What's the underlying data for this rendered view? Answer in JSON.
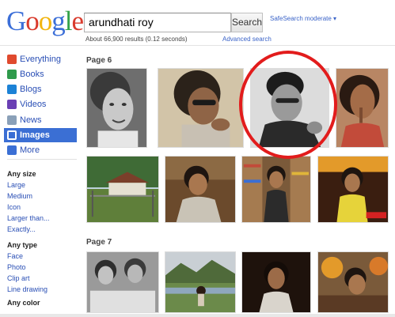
{
  "header": {
    "logo_letters": [
      {
        "ch": "G",
        "color": "#3c6fd8"
      },
      {
        "ch": "o",
        "color": "#d93b2d"
      },
      {
        "ch": "o",
        "color": "#f2b50f"
      },
      {
        "ch": "g",
        "color": "#3c6fd8"
      },
      {
        "ch": "l",
        "color": "#35a34a"
      },
      {
        "ch": "e",
        "color": "#d93b2d"
      }
    ],
    "search_value": "arundhati roy",
    "search_button": "Search",
    "safesearch": "SafeSearch moderate ▾",
    "result_stats": "About 66,900 results (0.12 seconds)",
    "advanced_search": "Advanced search"
  },
  "sidebar": {
    "items": [
      {
        "label": "Everything",
        "icon": "everything-icon",
        "color": "#e04a2e",
        "active": false
      },
      {
        "label": "Books",
        "icon": "books-icon",
        "color": "#2f9a4b",
        "active": false
      },
      {
        "label": "Blogs",
        "icon": "blogs-icon",
        "color": "#1c82d6",
        "active": false
      },
      {
        "label": "Videos",
        "icon": "videos-icon",
        "color": "#6a3fb4",
        "active": false
      },
      {
        "label": "News",
        "icon": "news-icon",
        "color": "#8aa0b8",
        "active": false
      },
      {
        "label": "Images",
        "icon": "images-icon",
        "color": "#ffffff",
        "active": true
      },
      {
        "label": "More",
        "icon": "more-icon",
        "color": "#3b6fd4",
        "active": false
      }
    ],
    "size_heading": "Any size",
    "size_options": [
      "Large",
      "Medium",
      "Icon",
      "Larger than...",
      "Exactly..."
    ],
    "type_heading": "Any type",
    "type_options": [
      "Face",
      "Photo",
      "Clip art",
      "Line drawing"
    ],
    "color_heading": "Any color"
  },
  "results": {
    "page6_label": "Page 6",
    "page7_label": "Page 7"
  },
  "colors": {
    "link": "#2a4fb5",
    "active_nav": "#3b6fd4",
    "highlight_ring": "#e21c1c"
  }
}
